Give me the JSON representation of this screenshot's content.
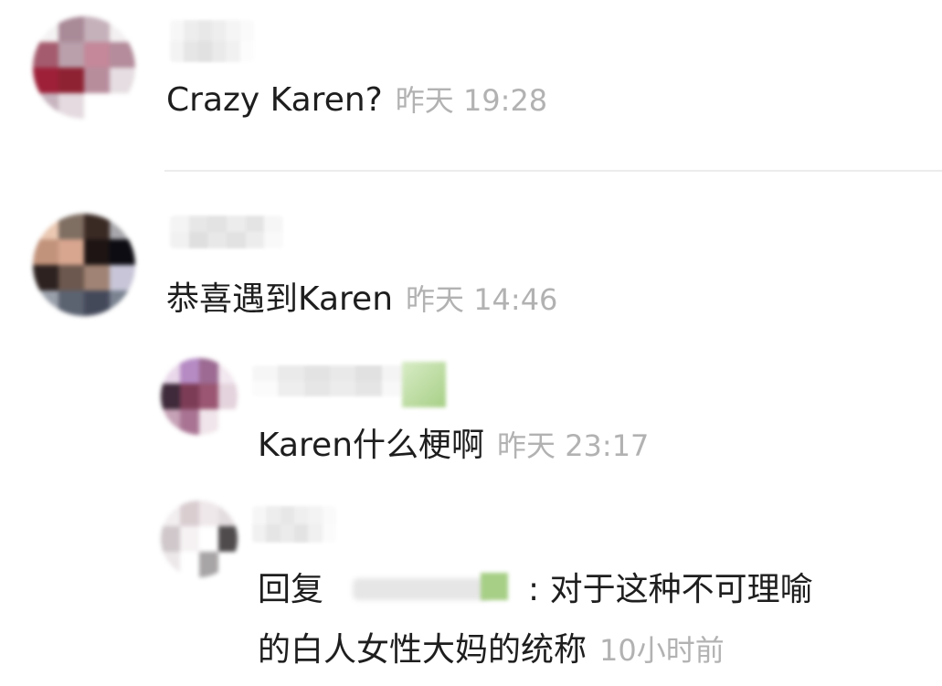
{
  "comments": [
    {
      "text": "Crazy Karen?",
      "time": "昨天 19:28",
      "avatar_colors": [
        "#f4f2f2",
        "#a98a97",
        "#c5b1ba",
        "#f3f0f1",
        "#a45b6d",
        "#b9a0ab",
        "#c4889a",
        "#b48c9b",
        "#9d2038",
        "#8e2233",
        "#b78d9c",
        "#e5dde1",
        "#c7b4be",
        "#e4dadf",
        "#ffffff",
        "#ffffff"
      ]
    },
    {
      "text": "恭喜遇到Karen",
      "time": "昨天 14:46",
      "avatar_colors": [
        "#eac8b2",
        "#7f6e62",
        "#3a2a24",
        "#a8a8ac",
        "#c2937b",
        "#d8a68f",
        "#1d1413",
        "#0c0c12",
        "#2d2220",
        "#6d584f",
        "#a08374",
        "#c7c5d7",
        "#9aa0aa",
        "#5b6270",
        "#44495a",
        "#7b8391"
      ],
      "replies": [
        {
          "text": "Karen什么梗啊",
          "time": "昨天 23:17",
          "avatar_colors": [
            "#e9d8ea",
            "#b68bc4",
            "#9c6a92",
            "#f2e8ef",
            "#3e2a3a",
            "#7d3c56",
            "#9a5672",
            "#e4d3dc",
            "#c6a2b6",
            "#a97493",
            "#f0e5ea",
            "#ffffff"
          ]
        },
        {
          "line1_prefix": "回复",
          "line1_suffix": ": 对于这种不可理喻",
          "line2": "的白人女性大妈的统称",
          "time": "10小时前",
          "avatar_colors": [
            "#f2eef0",
            "#d9cdd0",
            "#efe8ea",
            "#e4dde0",
            "#cfc7ca",
            "#f6f2f3",
            "#ffffff",
            "#4f4b4d",
            "#ece7e9",
            "#ffffff",
            "#a8a5a6",
            "#ffffff"
          ]
        }
      ]
    }
  ]
}
